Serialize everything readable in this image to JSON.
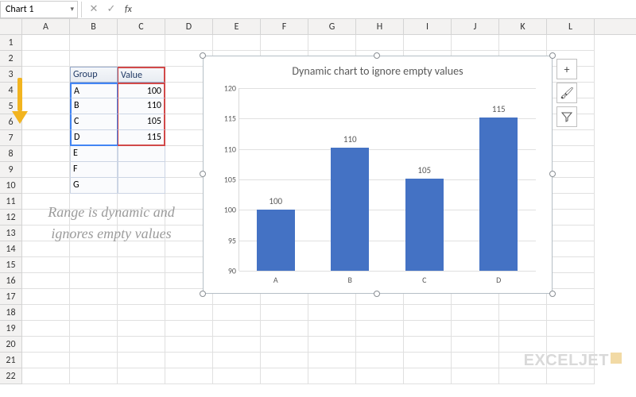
{
  "formula_bar": {
    "name_box": "Chart 1",
    "cancel": "✕",
    "confirm": "✓",
    "fx": "fx",
    "formula": ""
  },
  "columns": [
    "A",
    "B",
    "C",
    "D",
    "E",
    "F",
    "G",
    "H",
    "I",
    "J",
    "K",
    "L"
  ],
  "rows": [
    "1",
    "2",
    "3",
    "4",
    "5",
    "6",
    "7",
    "8",
    "9",
    "10",
    "11",
    "12",
    "13",
    "14",
    "15",
    "16",
    "17",
    "18",
    "19",
    "20",
    "21",
    "22"
  ],
  "table": {
    "headers": {
      "group": "Group",
      "value": "Value"
    },
    "data": [
      {
        "group": "A",
        "value": "100"
      },
      {
        "group": "B",
        "value": "110"
      },
      {
        "group": "C",
        "value": "105"
      },
      {
        "group": "D",
        "value": "115"
      },
      {
        "group": "E",
        "value": ""
      },
      {
        "group": "F",
        "value": ""
      },
      {
        "group": "G",
        "value": ""
      }
    ]
  },
  "annotation": "Range is dynamic and ignores empty values",
  "chart_data": {
    "type": "bar",
    "title": "Dynamic chart to ignore empty values",
    "categories": [
      "A",
      "B",
      "C",
      "D"
    ],
    "values": [
      100,
      110,
      105,
      115
    ],
    "ylim": [
      90,
      120
    ],
    "yticks": [
      90,
      95,
      100,
      105,
      110,
      115,
      120
    ],
    "xlabel": "",
    "ylabel": ""
  },
  "tools": {
    "plus": "+",
    "brush": "🖌",
    "filter": "▾"
  },
  "watermark": {
    "excel": "EXCEL",
    "jet": "JET"
  }
}
